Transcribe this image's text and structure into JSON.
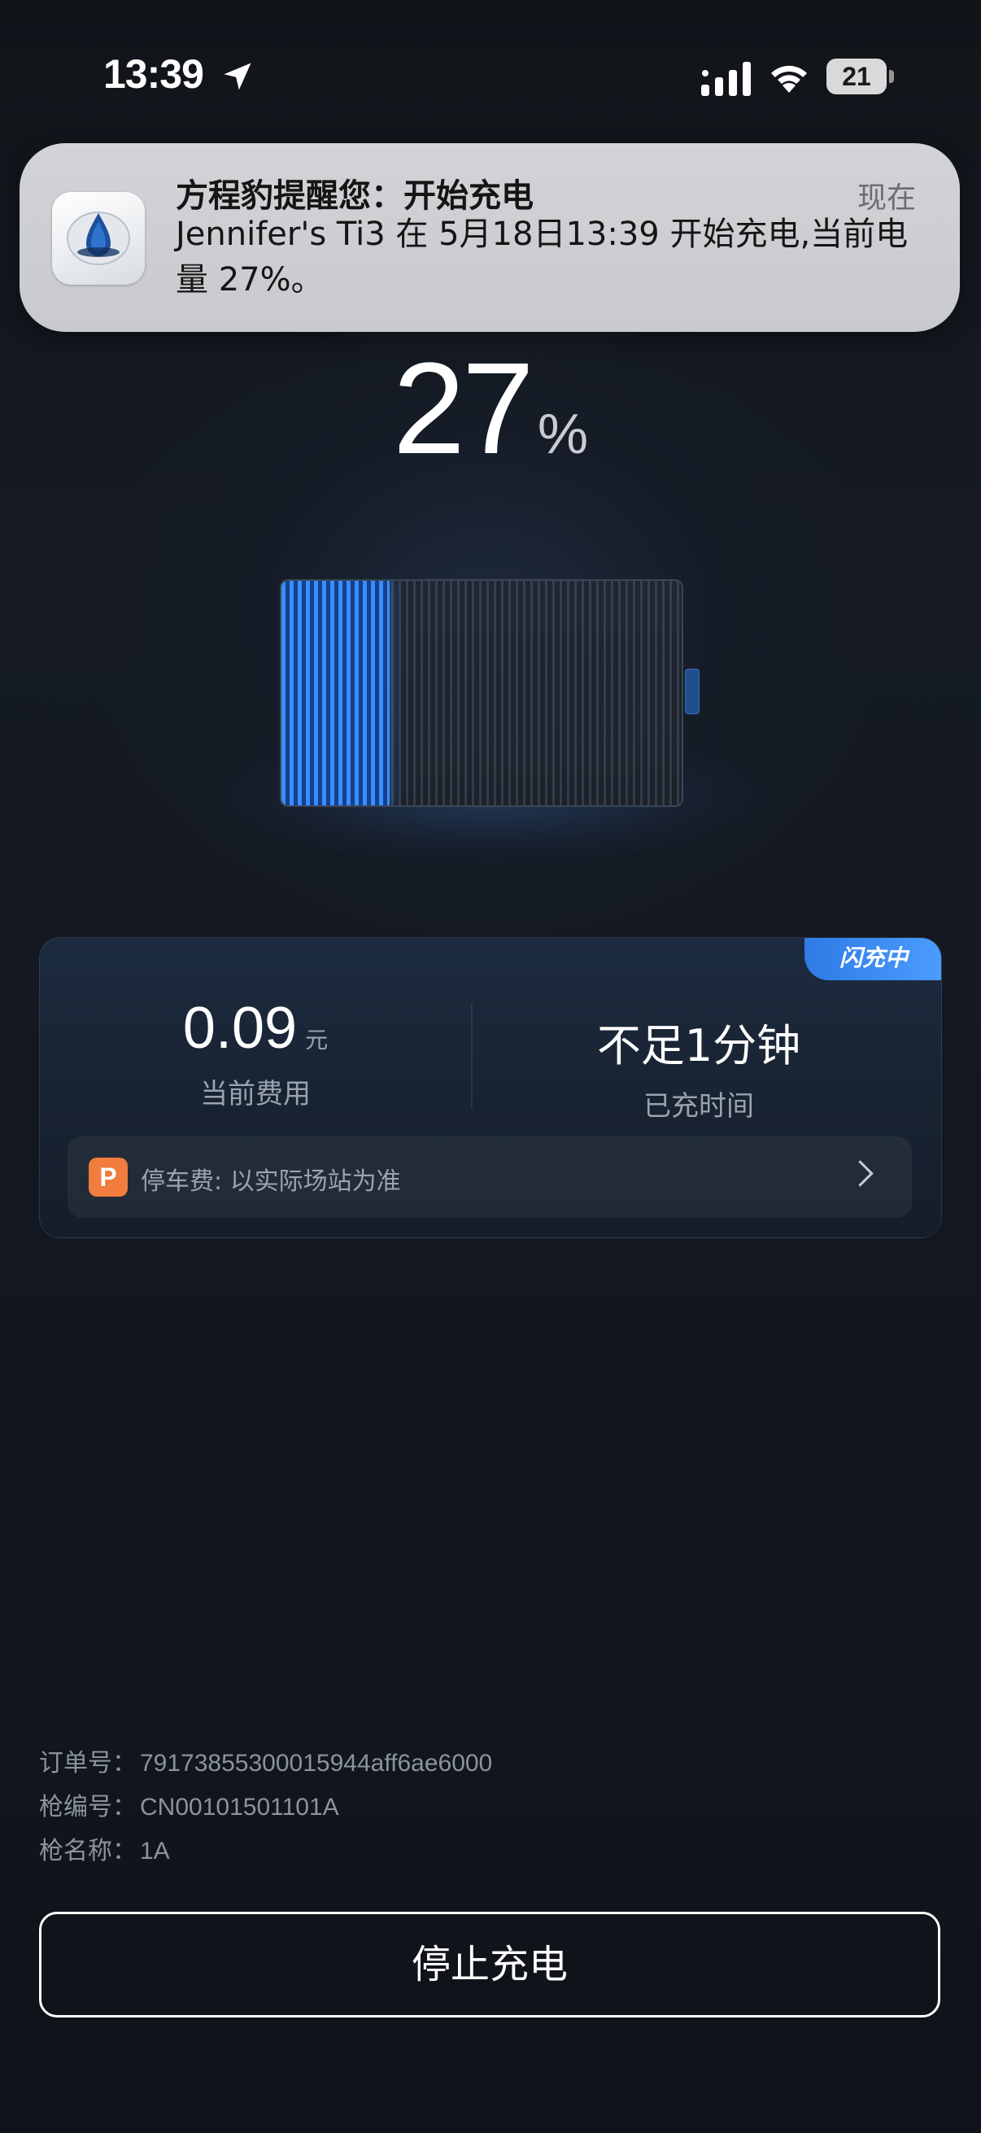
{
  "status_bar": {
    "time": "13:39",
    "battery_level": "21",
    "icons": [
      "location-arrow-icon",
      "cellular-signal-icon",
      "wifi-icon",
      "battery-icon"
    ]
  },
  "notification": {
    "app_icon": "app-logo-icon",
    "title": "方程豹提醒您：开始充电",
    "time": "现在",
    "body": "Jennifer's Ti3 在 5月18日13:39 开始充电,当前电量 27%。"
  },
  "charge": {
    "percent": "27",
    "percent_unit": "%",
    "level_fraction": 0.27
  },
  "card": {
    "badge": "闪充中",
    "fee_value": "0.09",
    "fee_unit": "元",
    "fee_label": "当前费用",
    "time_value": "不足1分钟",
    "time_label": "已充时间",
    "parking_icon": "P",
    "parking_text": "停车费: 以实际场站为准"
  },
  "order": {
    "order_no_label": "订单号：",
    "order_no": "7917385530001​5944aff6ae6000",
    "gun_no_label": "枪编号：",
    "gun_no": "CN00101501101A",
    "gun_name_label": "枪名称：",
    "gun_name": "1A"
  },
  "actions": {
    "stop_label": "停止充电"
  },
  "colors": {
    "accent": "#3a8dff",
    "parking_icon": "#f07c3d",
    "background": "#12161d"
  }
}
